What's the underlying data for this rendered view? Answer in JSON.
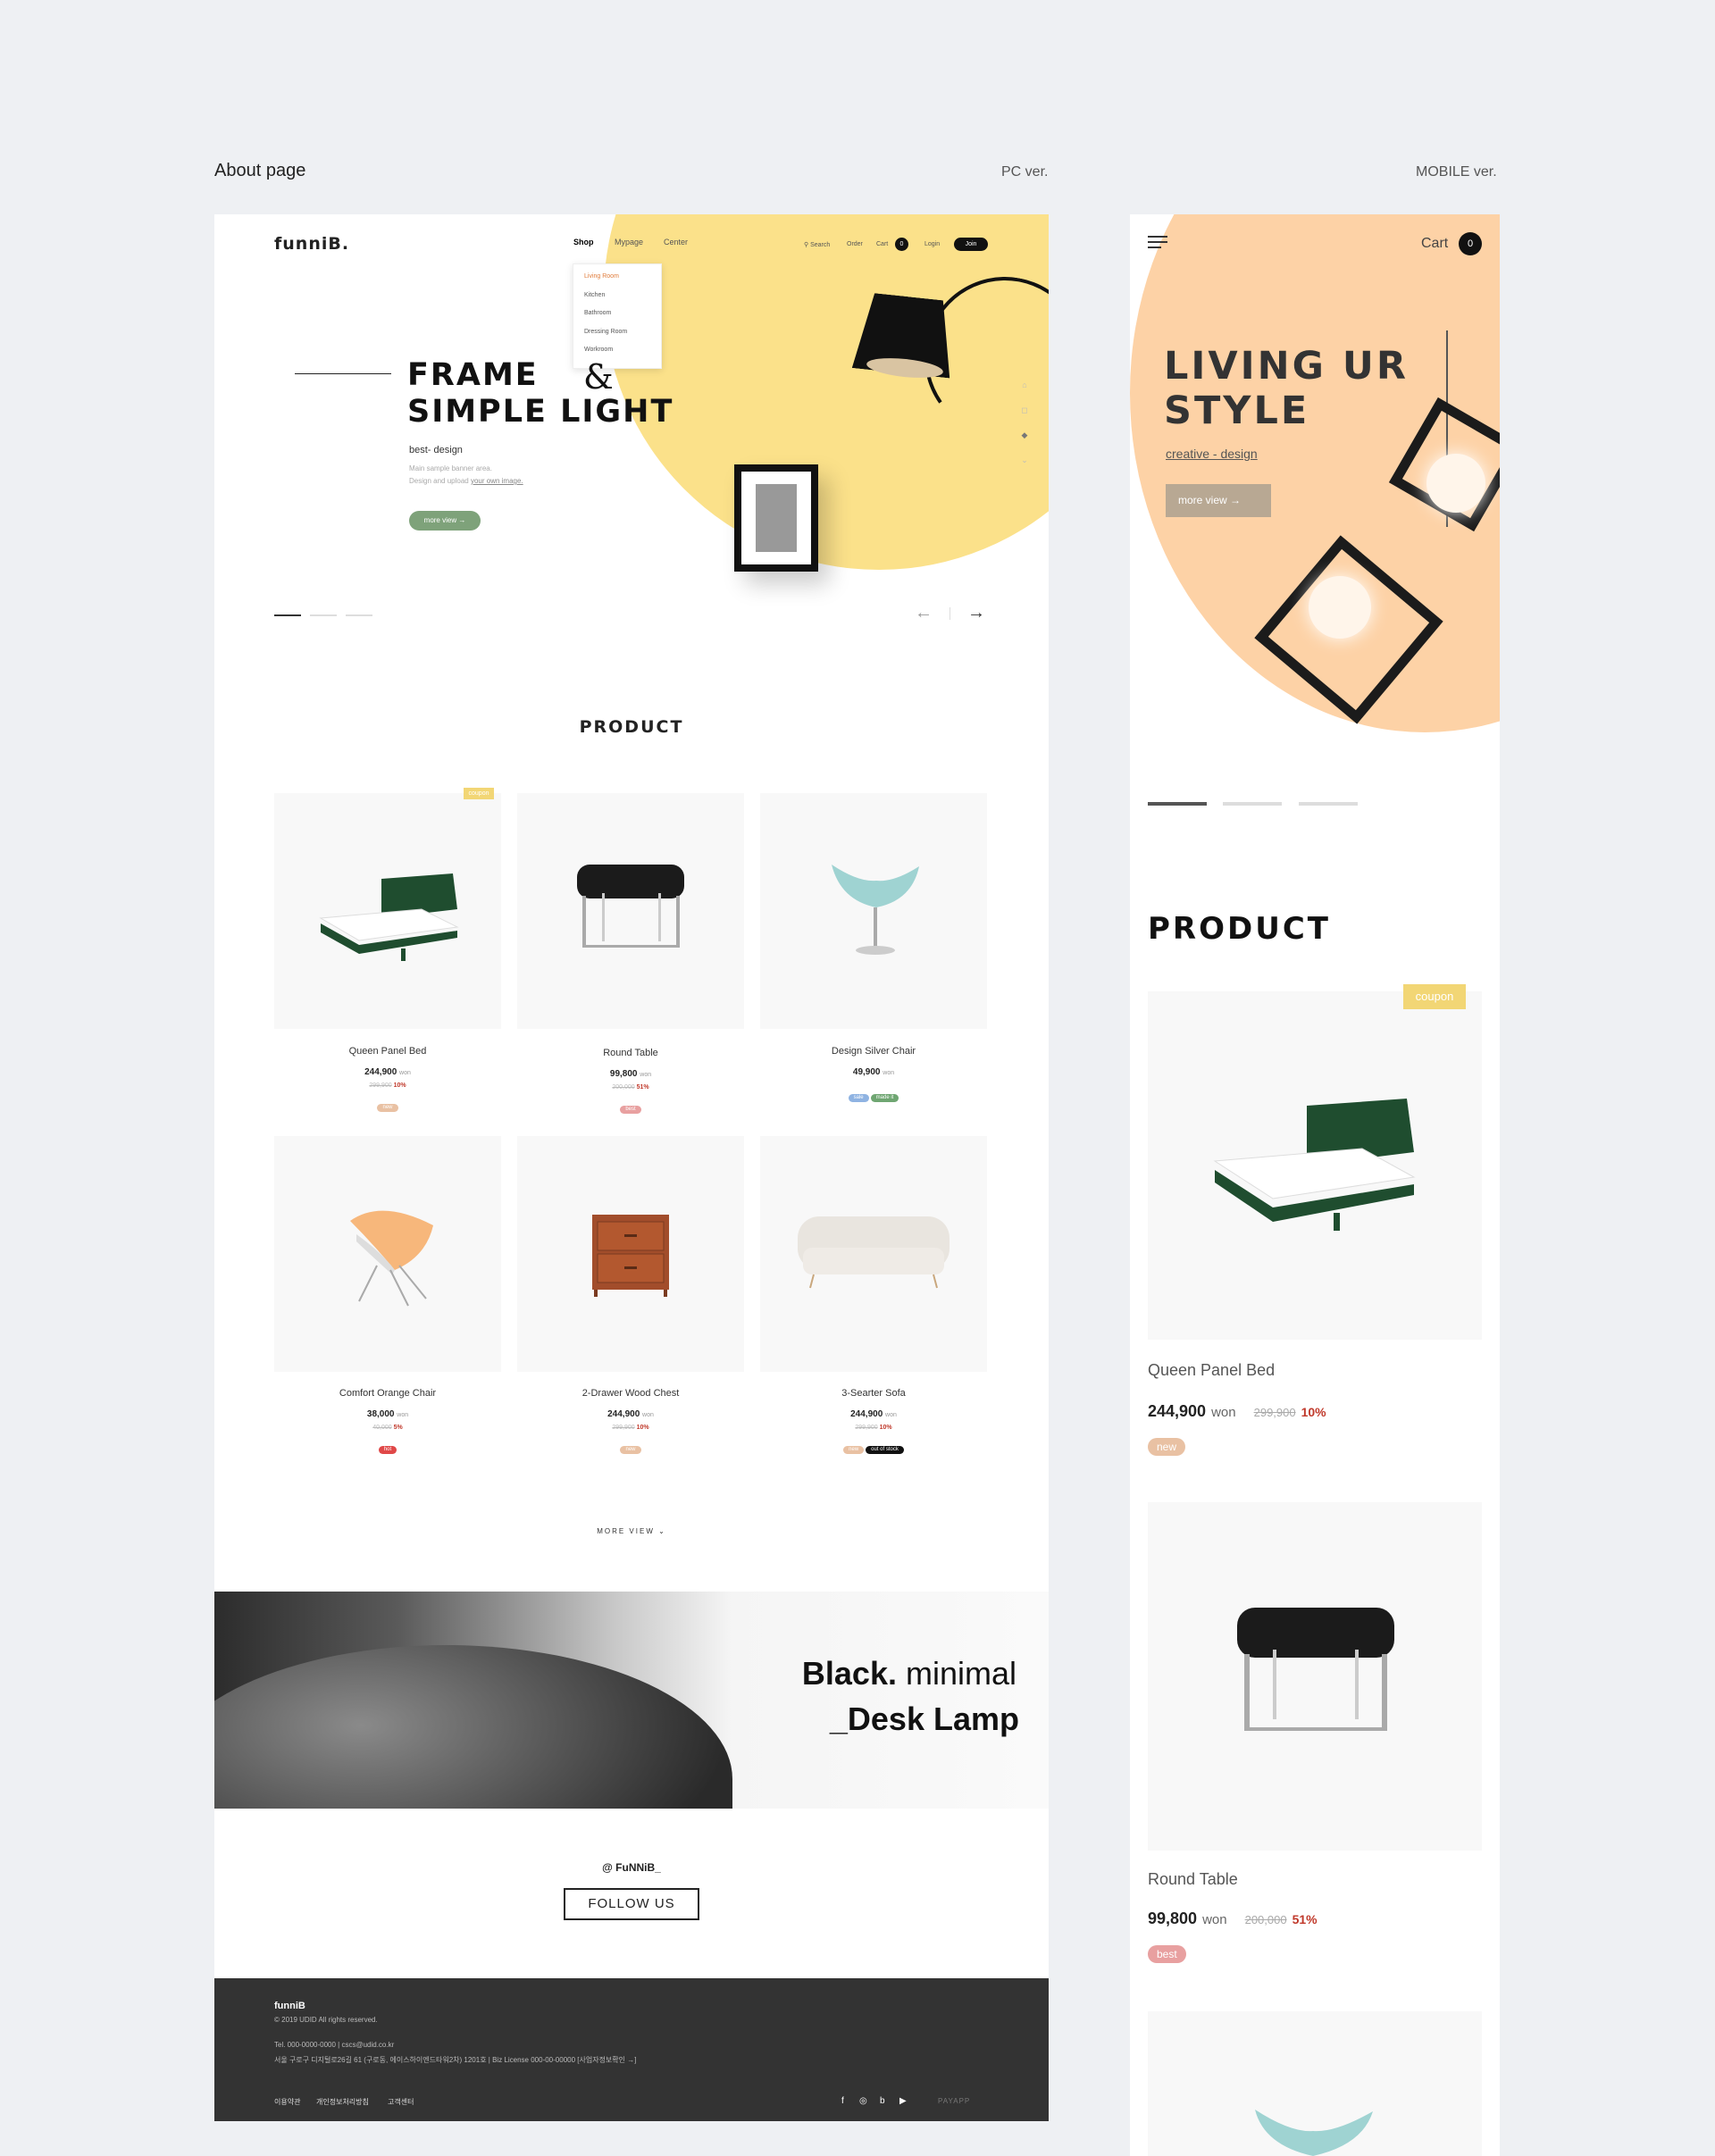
{
  "labels": {
    "about": "About page",
    "pc": "PC ver.",
    "mobile": "MOBILE ver."
  },
  "pc": {
    "logo": "funniB.",
    "nav": [
      "Shop",
      "Mypage",
      "Center"
    ],
    "util": {
      "search": "Search",
      "order": "Order",
      "cart": "Cart",
      "cart_count": "0",
      "login": "Login",
      "join": "Join"
    },
    "dropdown": [
      "Living Room",
      "Kitchen",
      "Bathroom",
      "Dressing Room",
      "Workroom"
    ],
    "hero": {
      "title1": "FRAME",
      "amp": "&",
      "title2": "SIMPLE LIGHT",
      "sub": "best- design",
      "desc1": "Main sample banner area.",
      "desc2_a": "Design and upload",
      "desc2_b": "your own image.",
      "more": "more view →"
    },
    "product_title": "PRODUCT",
    "coupon": "coupon",
    "products": [
      {
        "name": "Queen Panel Bed",
        "price": "244,900",
        "won": "won",
        "orig": "299,900",
        "disc": "10%",
        "badges": [
          {
            "label": "new",
            "color": "#e9c1a3"
          }
        ]
      },
      {
        "name": "Round Table",
        "price": "99,800",
        "won": "won",
        "orig": "200,000",
        "disc": "51%",
        "badges": [
          {
            "label": "best",
            "color": "#e8a0a0"
          }
        ]
      },
      {
        "name": "Design Silver Chair",
        "price": "49,900",
        "won": "won",
        "orig": "",
        "disc": "",
        "badges": [
          {
            "label": "sale",
            "color": "#8fb3e2"
          },
          {
            "label": "made it",
            "color": "#6fa672"
          }
        ]
      },
      {
        "name": "Comfort Orange Chair",
        "price": "38,000",
        "won": "won",
        "orig": "40,000",
        "disc": "5%",
        "badges": [
          {
            "label": "hot",
            "color": "#e04848"
          }
        ]
      },
      {
        "name": "2-Drawer Wood Chest",
        "price": "244,900",
        "won": "won",
        "orig": "299,900",
        "disc": "10%",
        "badges": [
          {
            "label": "new",
            "color": "#e9c1a3"
          }
        ]
      },
      {
        "name": "3-Searter Sofa",
        "price": "244,900",
        "won": "won",
        "orig": "299,900",
        "disc": "10%",
        "badges": [
          {
            "label": "new",
            "color": "#e9c1a3"
          },
          {
            "label": "out of stock",
            "color": "#111111"
          }
        ]
      }
    ],
    "more_view": "MORE VIEW ⌄",
    "banner": {
      "bold": "Black.",
      "light": " minimal",
      "line2": "_Desk Lamp"
    },
    "follow": {
      "handle": "@ FuNNiB_",
      "button": "FOLLOW US"
    },
    "footer": {
      "logo": "funniB",
      "copy": "© 2019 UDID All rights reserved.",
      "contact": "Tel. 000-0000-0000  |  cscs@udid.co.kr",
      "address": "서울 구로구 디지털로26길 61 (구로동, 에이스하이엔드타워2차) 1201호  |  Biz License 000-00-00000   [사업자정보확인 →]",
      "links": [
        "이용약관",
        "개인정보처리방침",
        "고객센터"
      ],
      "social": [
        "f",
        "◎",
        "b",
        "▶"
      ],
      "payapp": "PAYAPP"
    }
  },
  "mobile": {
    "cart": "Cart",
    "cart_count": "0",
    "hero": {
      "line1": "LIVING UR",
      "line2": "STYLE",
      "sub": "creative - design",
      "more": "more view  →"
    },
    "product_title": "PRODUCT",
    "coupon": "coupon",
    "products": [
      {
        "name": "Queen Panel Bed",
        "price": "244,900",
        "won": "won",
        "orig": "299,900",
        "disc": "10%",
        "badge": "new",
        "badge_color": "#e9c1a3"
      },
      {
        "name": "Round Table",
        "price": "99,800",
        "won": "won",
        "orig": "200,000",
        "disc": "51%",
        "badge": "best",
        "badge_color": "#e8a0a0"
      }
    ]
  },
  "colors": {
    "yellow": "#fbe18a",
    "peach": "#fdd2a6",
    "green_button": "#7ea27a",
    "footer": "#333333"
  }
}
